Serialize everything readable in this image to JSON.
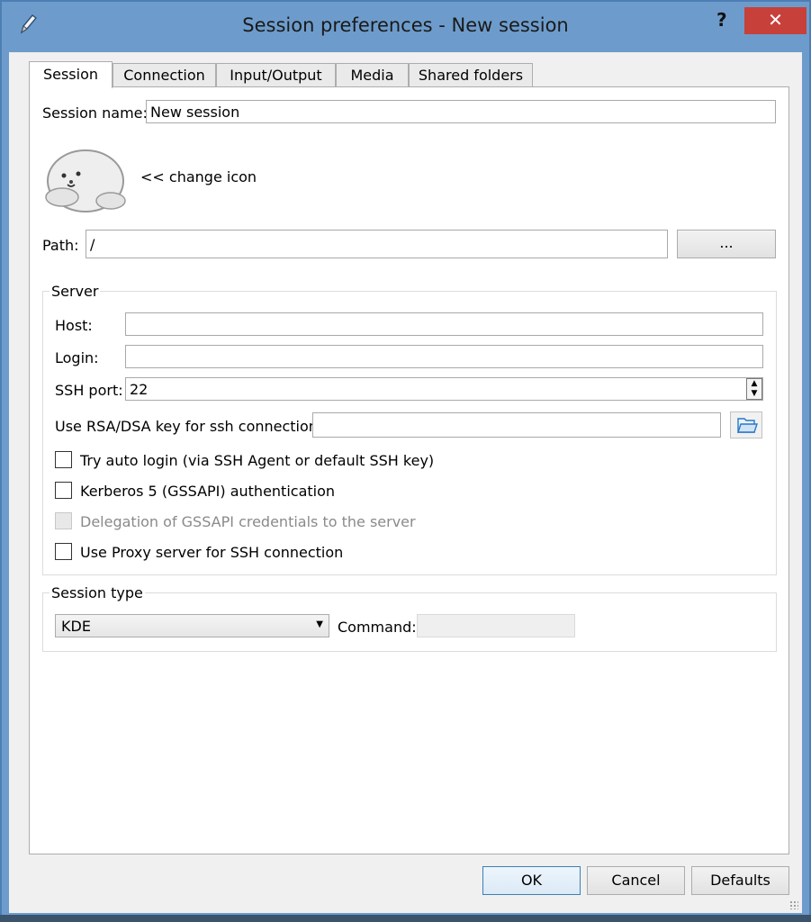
{
  "window": {
    "title": "Session preferences - New session",
    "help_label": "?",
    "close_label": "✕"
  },
  "tabs": [
    {
      "label": "Session"
    },
    {
      "label": "Connection"
    },
    {
      "label": "Input/Output"
    },
    {
      "label": "Media"
    },
    {
      "label": "Shared folders"
    }
  ],
  "session": {
    "name_label": "Session name:",
    "name_value": "New session",
    "change_icon_label": "<< change icon",
    "path_label": "Path:",
    "path_value": "/",
    "browse_label": "..."
  },
  "server": {
    "group_title": "Server",
    "host_label": "Host:",
    "host_value": "",
    "login_label": "Login:",
    "login_value": "",
    "ssh_port_label": "SSH port:",
    "ssh_port_value": "22",
    "rsa_label": "Use RSA/DSA key for ssh connection:",
    "rsa_value": "",
    "checkboxes": [
      {
        "label": "Try auto login (via SSH Agent or default SSH key)",
        "checked": false,
        "enabled": true
      },
      {
        "label": "Kerberos 5 (GSSAPI) authentication",
        "checked": false,
        "enabled": true
      },
      {
        "label": "Delegation of GSSAPI credentials to the server",
        "checked": false,
        "enabled": false
      },
      {
        "label": "Use Proxy server for SSH connection",
        "checked": false,
        "enabled": true
      }
    ]
  },
  "session_type": {
    "group_title": "Session type",
    "selected": "KDE",
    "command_label": "Command:",
    "command_value": ""
  },
  "buttons": {
    "ok": "OK",
    "cancel": "Cancel",
    "defaults": "Defaults"
  },
  "colors": {
    "titlebar": "#6d9ccc",
    "close": "#c7403a",
    "default_button_border": "#3c7fb1"
  }
}
